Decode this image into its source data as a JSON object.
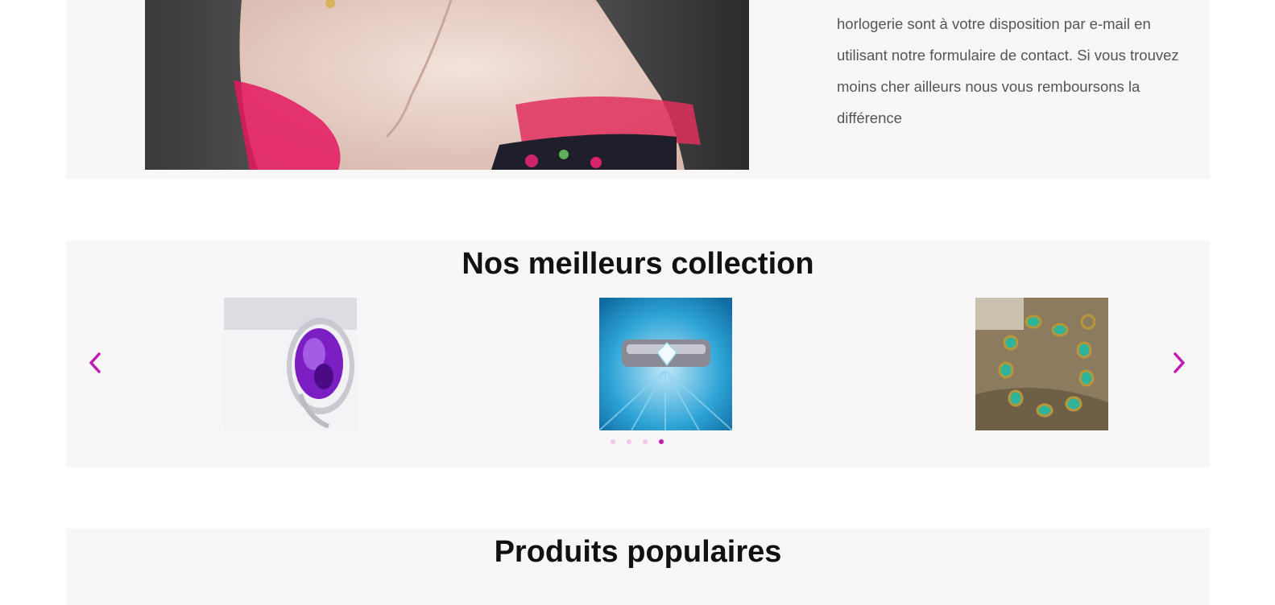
{
  "about": {
    "lines": [
      "horlogerie sont à votre disposition par e-mail en",
      "utilisant notre formulaire de contact. Si vous trouvez",
      "moins cher ailleurs nous vous remboursons la",
      "différence"
    ]
  },
  "collection": {
    "title": "Nos meilleurs collection",
    "prev_icon": "chevron-left-icon",
    "next_icon": "chevron-right-icon",
    "slides": [
      {
        "name": "purple-gem-ring"
      },
      {
        "name": "diamond-ring-blue"
      },
      {
        "name": "turquoise-bracelet"
      }
    ],
    "dots": 4,
    "active_dot": 4
  },
  "popular": {
    "title": "Produits populaires"
  },
  "colors": {
    "accent": "#c21ab4",
    "dot_inactive": "#f1c7ea",
    "section_bg": "#f8f6f7",
    "text": "#555555"
  }
}
